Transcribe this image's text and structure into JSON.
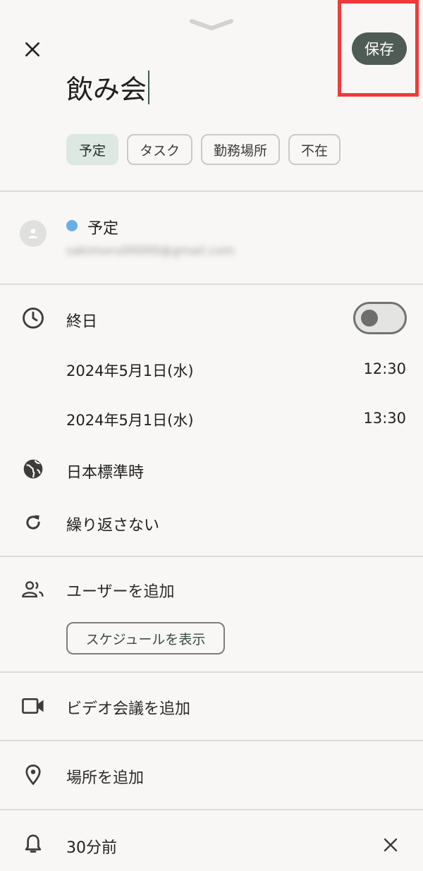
{
  "header": {
    "save_label": "保存",
    "title": "飲み会",
    "icons": {
      "handle": "chevron-down-icon",
      "close": "close-icon"
    }
  },
  "event_types": [
    {
      "label": "予定",
      "selected": true
    },
    {
      "label": "タスク",
      "selected": false
    },
    {
      "label": "勤務場所",
      "selected": false
    },
    {
      "label": "不在",
      "selected": false
    }
  ],
  "calendar": {
    "name": "予定",
    "email": "sakimoru00000@gmail.com",
    "color": "#6aaee6"
  },
  "time": {
    "all_day_label": "終日",
    "all_day_on": false,
    "start_date": "2024年5月1日(水)",
    "start_time": "12:30",
    "end_date": "2024年5月1日(水)",
    "end_time": "13:30",
    "timezone": "日本標準時",
    "repeat": "繰り返さない"
  },
  "guests": {
    "add_label": "ユーザーを追加",
    "schedule_button": "スケジュールを表示"
  },
  "video": {
    "label": "ビデオ会議を追加"
  },
  "location": {
    "label": "場所を追加"
  },
  "notification": {
    "label": "30分前"
  },
  "colors": {
    "save_button": "#4f5b55",
    "chip_selected": "#dde8e2",
    "highlight": "#f03a3a",
    "background": "#f8f7f5"
  }
}
